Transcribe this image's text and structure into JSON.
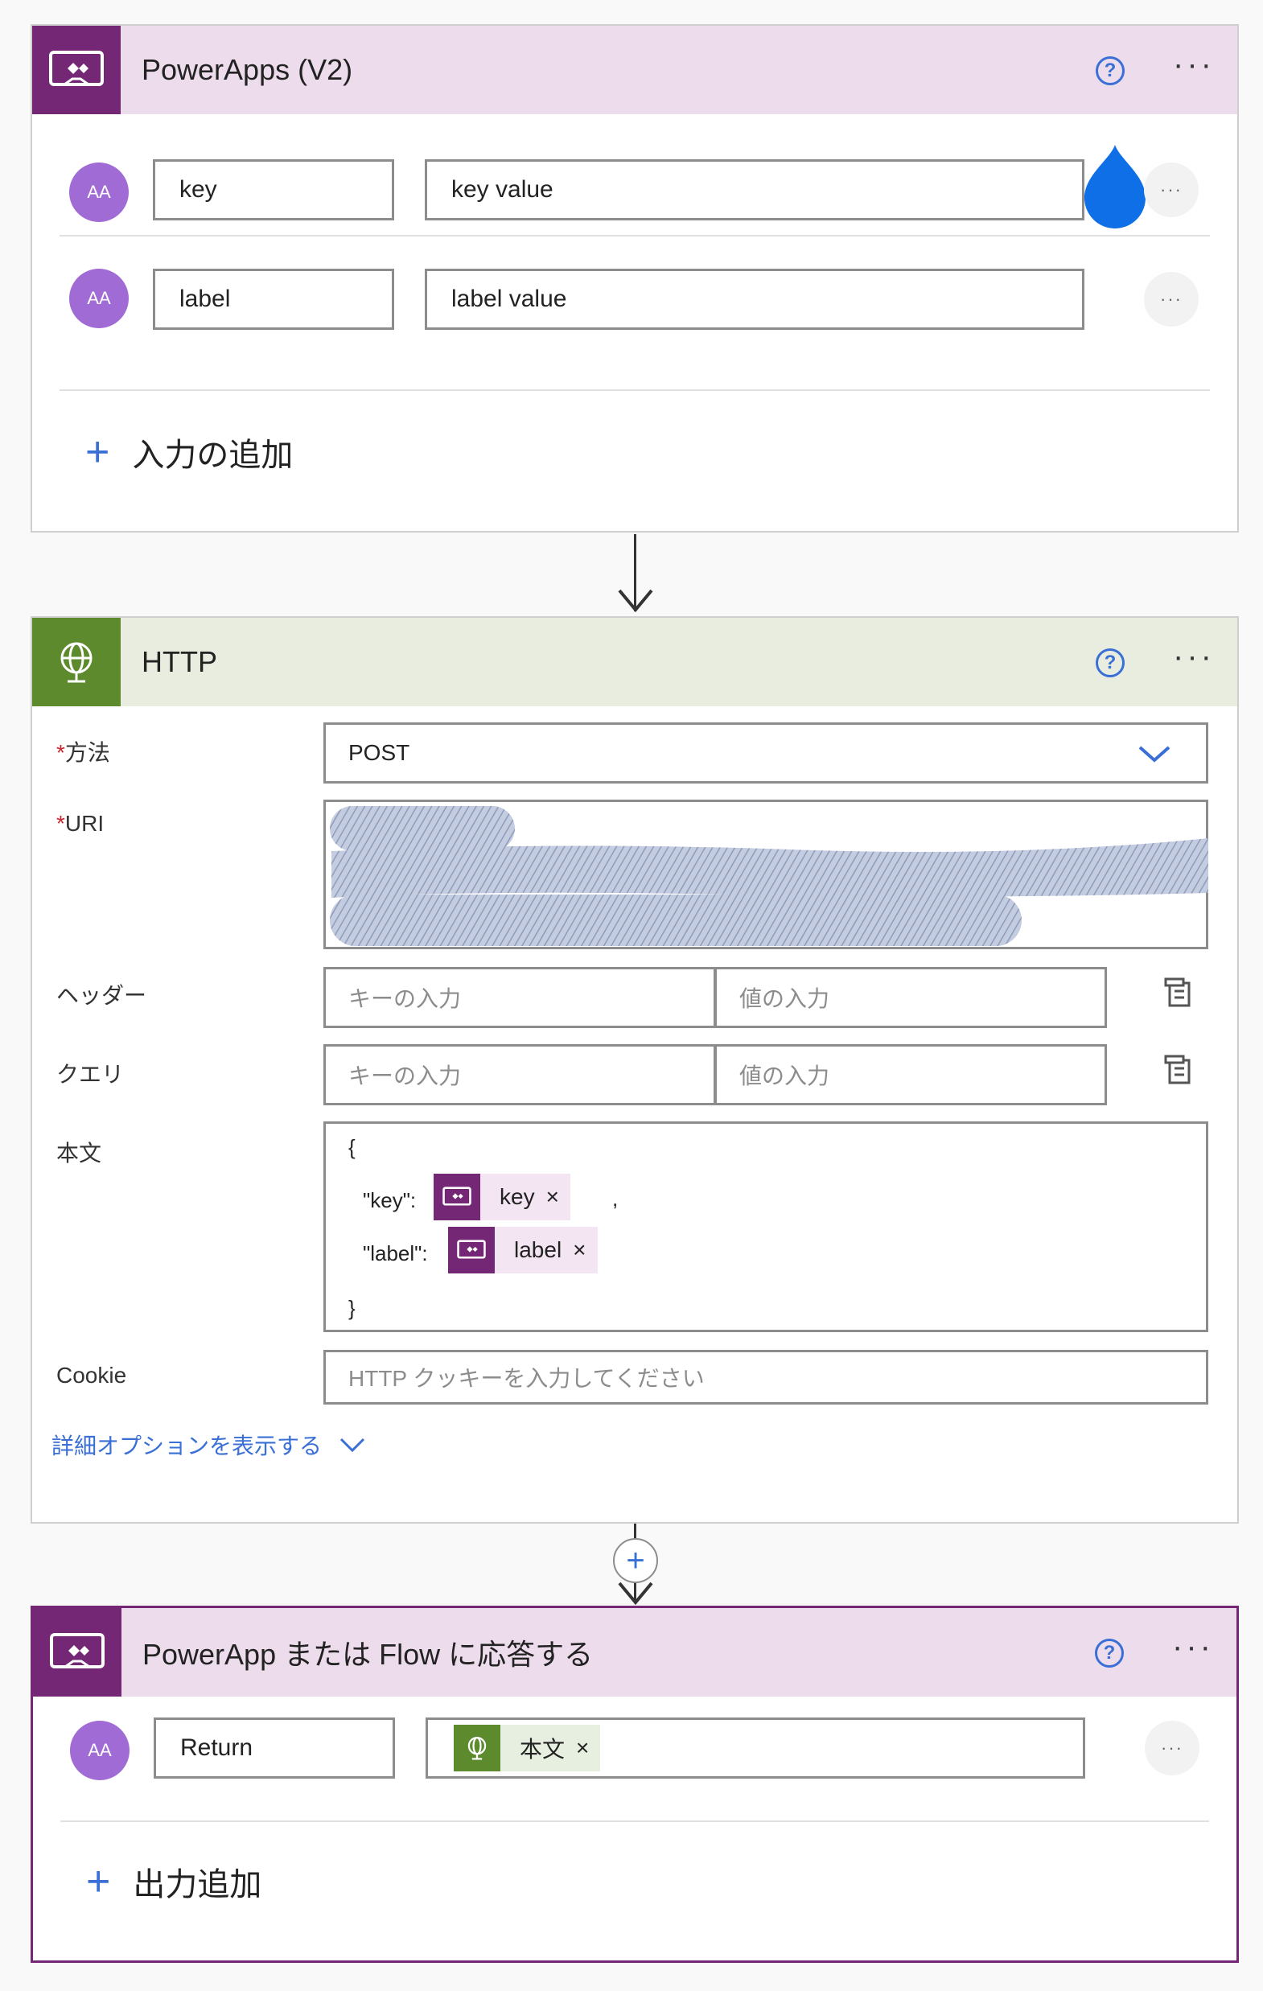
{
  "trigger": {
    "title": "PowerApps (V2)",
    "help": "?",
    "more": "···",
    "accent": "#742774",
    "header_bg": "#eddcec",
    "inputs": [
      {
        "name": "key",
        "value": "key value",
        "avatar": "AA"
      },
      {
        "name": "label",
        "value": "label value",
        "avatar": "AA"
      }
    ],
    "row_more": "···",
    "add_label": "入力の追加"
  },
  "http": {
    "title": "HTTP",
    "help": "?",
    "more": "···",
    "accent": "#5c8a2c",
    "header_bg": "#e9eddf",
    "method_label": "方法",
    "method_value": "POST",
    "uri_label": "URI",
    "header_label": "ヘッダー",
    "header_key_ph": "キーの入力",
    "header_val_ph": "値の入力",
    "query_label": "クエリ",
    "query_key_ph": "キーの入力",
    "query_val_ph": "値の入力",
    "body_label": "本文",
    "body": {
      "open": "{",
      "key_prefix": "\"key\":",
      "key_token": "key",
      "key_suffix": ",",
      "label_prefix": "\"label\":",
      "label_token": "label",
      "close": "}",
      "remove": "×"
    },
    "cookie_label": "Cookie",
    "cookie_ph": "HTTP クッキーを入力してください",
    "advanced_label": "詳細オプションを表示する"
  },
  "response": {
    "title": "PowerApp または Flow に応答する",
    "help": "?",
    "more": "···",
    "accent": "#742774",
    "header_bg": "#eddcec",
    "outputs": [
      {
        "name": "Return",
        "token": "本文",
        "avatar": "AA"
      }
    ],
    "row_more": "···",
    "remove": "×",
    "add_label": "出力追加"
  },
  "connector_plus": "+"
}
